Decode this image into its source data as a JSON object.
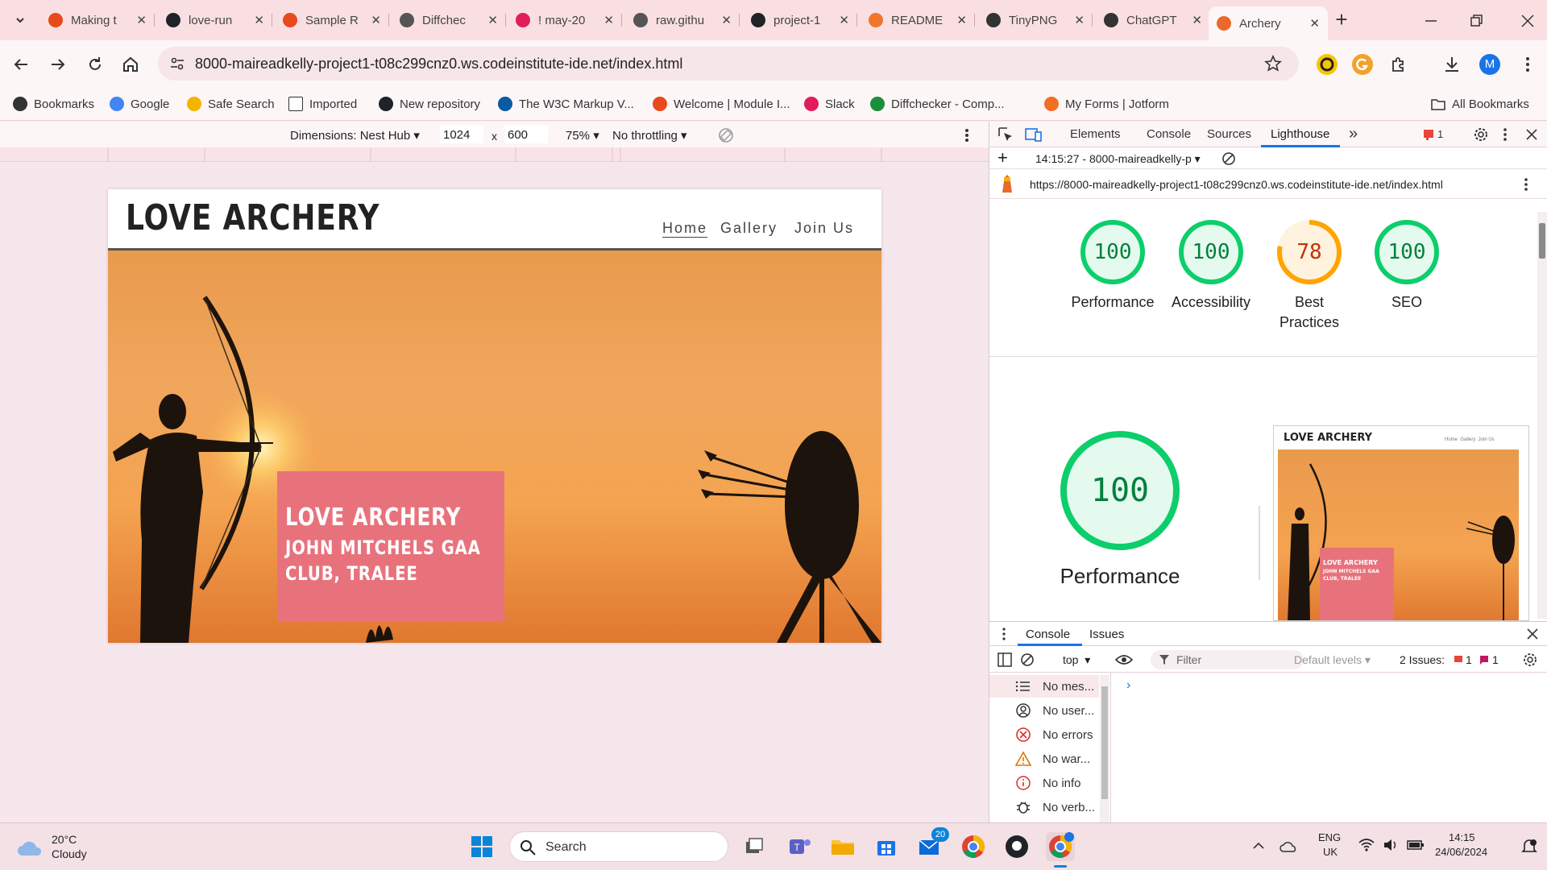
{
  "tabs": [
    {
      "title": "Making t",
      "icon": "opera-icon",
      "color": "#e8491d"
    },
    {
      "title": "love-run",
      "icon": "github-icon",
      "color": "#1f2328"
    },
    {
      "title": "Sample R",
      "icon": "opera-icon",
      "color": "#e8491d"
    },
    {
      "title": "Diffchec",
      "icon": "diffchecker-icon",
      "color": "#555555"
    },
    {
      "title": "! may-20",
      "icon": "slack-icon",
      "color": "#e01e5a"
    },
    {
      "title": "raw.githu",
      "icon": "globe-icon",
      "color": "#555555"
    },
    {
      "title": "project-1",
      "icon": "github-icon",
      "color": "#1f2328"
    },
    {
      "title": "README",
      "icon": "grammarly-icon",
      "color": "#f0762b"
    },
    {
      "title": "TinyPNG",
      "icon": "panda-icon",
      "color": "#333333"
    },
    {
      "title": "ChatGPT",
      "icon": "chatgpt-icon",
      "color": "#333333"
    },
    {
      "title": "Archery",
      "icon": "lighthouse-icon",
      "color": "#e96a2b",
      "active": true
    }
  ],
  "toolbar": {
    "url": "8000-mairead​kelly-project1-t08c299cnz0.ws.codeinstitute-ide.net/index.html",
    "profile_initial": "M"
  },
  "bookmarks": [
    {
      "label": "Bookmarks",
      "icon": "star-icon"
    },
    {
      "label": "Google",
      "icon": "google-icon"
    },
    {
      "label": "Safe Search",
      "icon": "check-icon"
    },
    {
      "label": "Imported",
      "icon": "folder-icon"
    },
    {
      "label": "New repository",
      "icon": "github-icon"
    },
    {
      "label": "The W3C Markup V...",
      "icon": "w3c-icon"
    },
    {
      "label": "Welcome | Module I...",
      "icon": "opera-icon"
    },
    {
      "label": "Slack",
      "icon": "slack-icon"
    },
    {
      "label": "Diffchecker - Comp...",
      "icon": "diffchecker-icon"
    },
    {
      "label": "My Forms | Jotform",
      "icon": "jotform-icon"
    }
  ],
  "all_bookmarks": "All Bookmarks",
  "device_toolbar": {
    "dimensions": "Dimensions: Nest Hub",
    "width": "1024",
    "x": "x",
    "height": "600",
    "zoom": "75%",
    "throttling": "No throttling"
  },
  "site": {
    "logo": "LOVE ARCHERY",
    "nav": [
      "Home",
      "Gallery",
      "Join Us"
    ],
    "hero_title": "LOVE ARCHERY",
    "hero_sub1": "JOHN MITCHELS GAA",
    "hero_sub2": "CLUB, TRALEE"
  },
  "devtools": {
    "tabs": [
      "Elements",
      "Console",
      "Sources",
      "Lighthouse"
    ],
    "active_tab": "Lighthouse",
    "issues_badge": "1",
    "report_time": "14:15:27 - 8000-maireadkelly-p",
    "report_url": "https://8000-maireadkelly-project1-t08c299cnz0.ws.codeinstitute-ide.net/index.html",
    "scores": [
      {
        "label": "Performance",
        "value": 100,
        "color": "#0cce6b"
      },
      {
        "label": "Accessibility",
        "value": 100,
        "color": "#0cce6b"
      },
      {
        "label": "Best Practices",
        "value": 78,
        "color": "#ffa400"
      },
      {
        "label": "SEO",
        "value": 100,
        "color": "#0cce6b"
      }
    ],
    "big_score": {
      "label": "Performance",
      "value": 100
    },
    "thumb": {
      "logo": "LOVE ARCHERY",
      "nav": "Home  Gallery  Join Us",
      "t1": "LOVE ARCHERY",
      "t2": "JOHN MITCHELS GAA",
      "t3": "CLUB, TRALEE"
    }
  },
  "console": {
    "tabs": [
      "Console",
      "Issues"
    ],
    "context": "top",
    "filter_placeholder": "Filter",
    "levels": "Default levels",
    "issues": "2 Issues:",
    "issue_count_a": "1",
    "issue_count_b": "1",
    "rows": [
      {
        "label": "No mes...",
        "icon": "list-icon"
      },
      {
        "label": "No user...",
        "icon": "user-icon"
      },
      {
        "label": "No errors",
        "icon": "error-icon"
      },
      {
        "label": "No war...",
        "icon": "warning-icon"
      },
      {
        "label": "No info",
        "icon": "info-icon"
      },
      {
        "label": "No verb...",
        "icon": "bug-icon"
      }
    ]
  },
  "taskbar": {
    "weather_temp": "20°C",
    "weather_desc": "Cloudy",
    "search_placeholder": "Search",
    "mail_badge": "20",
    "lang1": "ENG",
    "lang2": "UK",
    "time": "14:15",
    "date": "24/06/2024"
  }
}
